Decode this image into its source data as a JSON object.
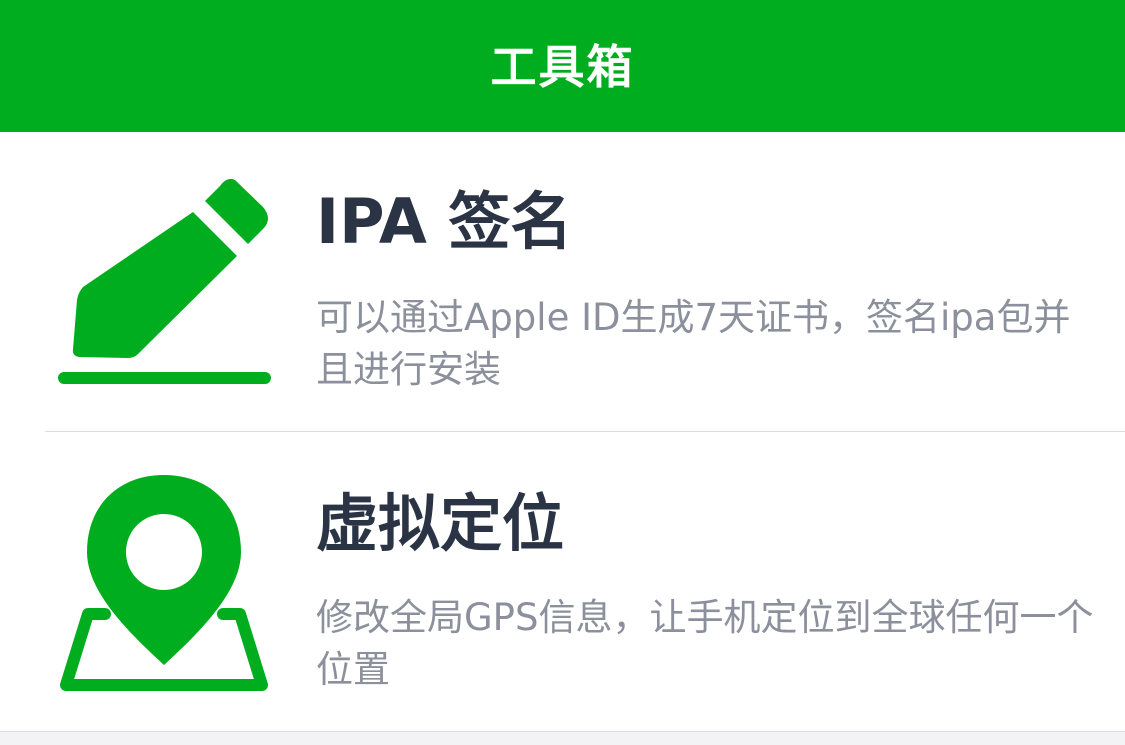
{
  "navbar": {
    "title": "工具箱",
    "color": "#00ad1f"
  },
  "tools": [
    {
      "title": "IPA 签名",
      "description": "可以通过Apple ID生成7天证书，签名ipa包并且进行安装",
      "icon": "pencil-icon"
    },
    {
      "title": "虚拟定位",
      "description": "修改全局GPS信息，让手机定位到全球任何一个位置",
      "icon": "location-map-icon"
    }
  ],
  "colors": {
    "accent": "#00ad1f",
    "title_text": "#2b3444",
    "description_text": "#8b909c",
    "background": "#f3f3f5"
  }
}
